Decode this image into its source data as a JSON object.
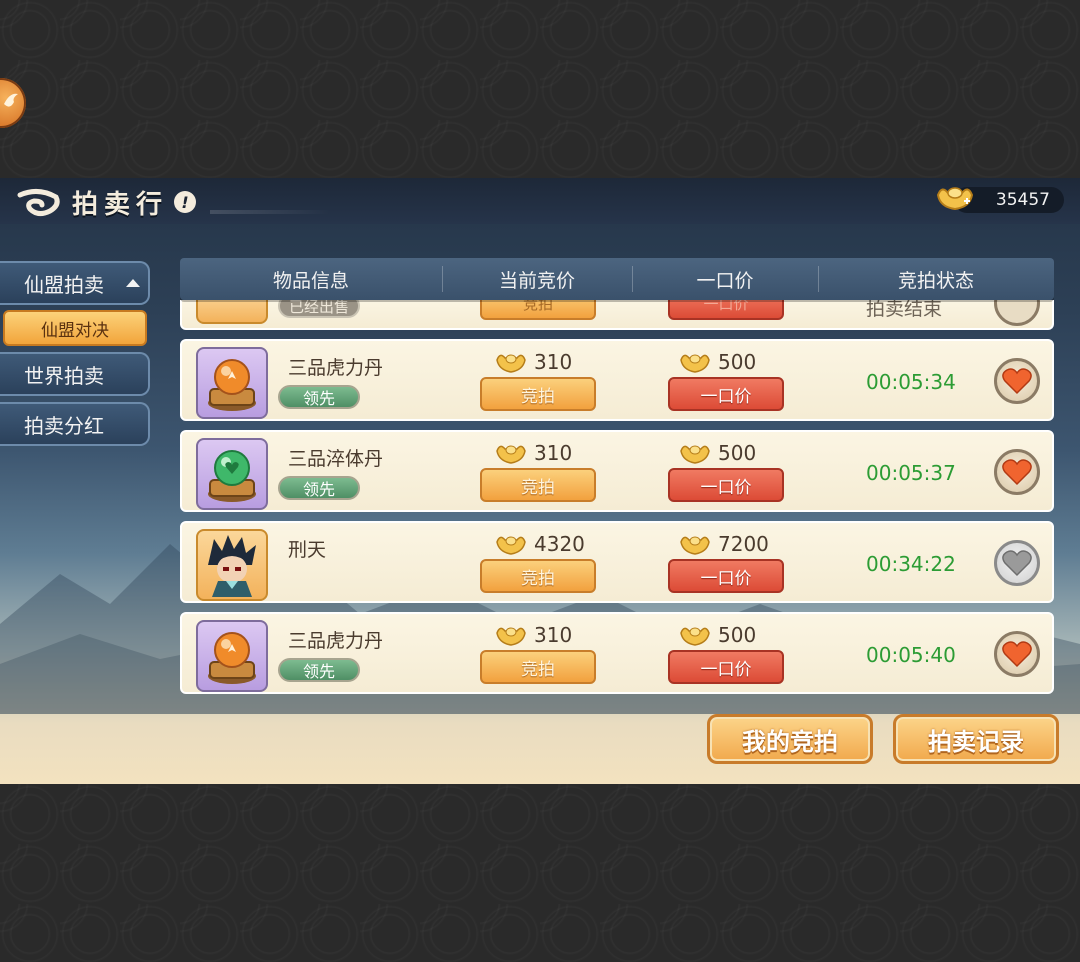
{
  "header": {
    "title": "拍卖行",
    "currency_amount": "35457"
  },
  "sidebar": {
    "tabs": [
      {
        "label": "仙盟拍卖"
      },
      {
        "label": "世界拍卖"
      },
      {
        "label": "拍卖分红"
      }
    ],
    "subtabs": [
      {
        "label": "仙盟对决"
      }
    ]
  },
  "table": {
    "columns": [
      "物品信息",
      "当前竞价",
      "一口价",
      "竞拍状态"
    ],
    "partial_row": {
      "badge": "已经出售",
      "bid_label": "竞拍",
      "buy_label": "一口价",
      "status": "拍卖结束"
    },
    "rows": [
      {
        "name": "三品虎力丹",
        "badge": "领先",
        "current_bid": "310",
        "buyout": "500",
        "bid_label": "竞拍",
        "buy_label": "一口价",
        "timer": "00:05:34",
        "favorite": true,
        "icon": "orange-pill-icon"
      },
      {
        "name": "三品淬体丹",
        "badge": "领先",
        "current_bid": "310",
        "buyout": "500",
        "bid_label": "竞拍",
        "buy_label": "一口价",
        "timer": "00:05:37",
        "favorite": true,
        "icon": "green-pill-icon"
      },
      {
        "name": "刑天",
        "badge": "",
        "current_bid": "4320",
        "buyout": "7200",
        "bid_label": "竞拍",
        "buy_label": "一口价",
        "timer": "00:34:22",
        "favorite": false,
        "icon": "character-portrait-icon"
      },
      {
        "name": "三品虎力丹",
        "badge": "领先",
        "current_bid": "310",
        "buyout": "500",
        "bid_label": "竞拍",
        "buy_label": "一口价",
        "timer": "00:05:40",
        "favorite": true,
        "icon": "orange-pill-icon"
      }
    ]
  },
  "footer": {
    "my_bids_label": "我的竞拍",
    "records_label": "拍卖记录"
  },
  "colors": {
    "timer_green": "#2c9c34",
    "heart_active": "#f0642f",
    "heart_inactive": "#9a9a9a"
  }
}
